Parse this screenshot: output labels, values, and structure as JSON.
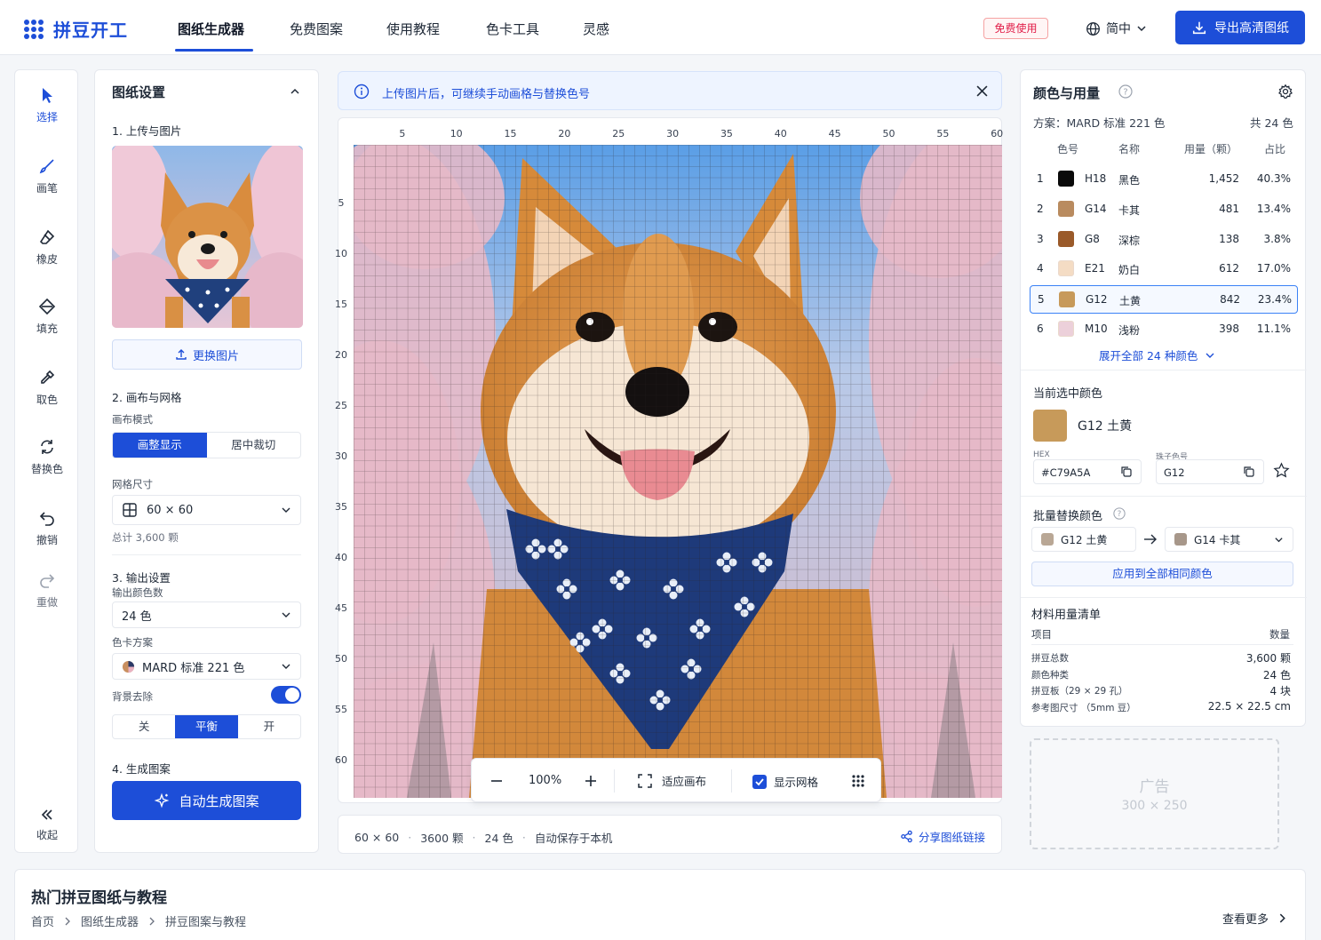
{
  "brand": {
    "name": "拼豆开工",
    "color": "#1d4ed8"
  },
  "nav": {
    "items": [
      "图纸生成器",
      "免费图案",
      "使用教程",
      "色卡工具",
      "灵感"
    ],
    "active": "图纸生成器",
    "free_badge": "免费使用",
    "language": "简中",
    "export_label": "导出高清图纸"
  },
  "tools": [
    {
      "label": "选择",
      "icon": "cursor-icon"
    },
    {
      "label": "画笔",
      "icon": "brush-icon"
    },
    {
      "label": "橡皮",
      "icon": "eraser-icon"
    },
    {
      "label": "填充",
      "icon": "fill-icon"
    },
    {
      "label": "取色",
      "icon": "eyedropper-icon"
    },
    {
      "label": "替换色",
      "icon": "replace-color-icon"
    },
    {
      "label": "撤销",
      "icon": "undo-icon"
    },
    {
      "label": "重做",
      "icon": "redo-icon"
    }
  ],
  "collapse_label": "收起",
  "settings": {
    "title": "图纸设置",
    "step1": "1. 上传与图片",
    "replace_image": "更换图片",
    "step2": "2. 画布与网格",
    "canvas_mode_label": "画布模式",
    "canvas_modes": [
      "画整显示",
      "居中裁切"
    ],
    "grid_size_label": "网格尺寸",
    "grid_size": "60 × 60",
    "total": "总计 3,600 颗",
    "step3": "3. 输出设置",
    "output_colors_label": "输出颜色数",
    "output_colors": "24 色",
    "palette_label": "色卡方案",
    "palette": "MARD 标准 221 色",
    "bg_remove_label": "背景去除",
    "bg_remove_on": true,
    "bg_levels": [
      "关",
      "平衡",
      "开"
    ],
    "bg_level_selected": "平衡",
    "step4": "4. 生成图案",
    "generate_label": "自动生成图案"
  },
  "banner": {
    "text": "上传图片后，可继续手动画格与替换色号"
  },
  "ruler": {
    "top": [
      "5",
      "10",
      "15",
      "20",
      "25",
      "30",
      "35",
      "40",
      "45",
      "50",
      "55",
      "60"
    ],
    "left": [
      "5",
      "10",
      "15",
      "20",
      "25",
      "30",
      "35",
      "40",
      "45",
      "50",
      "55",
      "60"
    ]
  },
  "canvas_toolbar": {
    "zoom": "100%",
    "fit_label": "适应画布",
    "show_grid_label": "显示网格",
    "show_grid": true
  },
  "status": {
    "items": [
      "60 × 60",
      "3600 颗",
      "24 色",
      "自动保存于本机"
    ],
    "share_label": "分享图纸链接"
  },
  "colors_panel": {
    "title": "颜色与用量",
    "scheme": "方案：MARD 标准 221 色",
    "count": "共 24 色",
    "headers": [
      "色号",
      "名称",
      "用量（颗）",
      "占比"
    ],
    "rows": [
      {
        "idx": "1",
        "code": "H18",
        "name": "黑色",
        "qty": "1,452",
        "pct": "40.3%",
        "color": "#0a0a0a"
      },
      {
        "idx": "2",
        "code": "G14",
        "name": "卡其",
        "qty": "481",
        "pct": "13.4%",
        "color": "#b98b5f"
      },
      {
        "idx": "3",
        "code": "G8",
        "name": "深棕",
        "qty": "138",
        "pct": "3.8%",
        "color": "#9a5a2a"
      },
      {
        "idx": "4",
        "code": "E21",
        "name": "奶白",
        "qty": "612",
        "pct": "17.0%",
        "color": "#f4dcc4"
      },
      {
        "idx": "5",
        "code": "G12",
        "name": "土黄",
        "qty": "842",
        "pct": "23.4%",
        "color": "#c79a5a"
      },
      {
        "idx": "6",
        "code": "M10",
        "name": "浅粉",
        "qty": "398",
        "pct": "11.1%",
        "color": "#ecd0da"
      }
    ],
    "selected_row": "5",
    "expand_label": "展开全部 24 种颜色",
    "current_title": "当前选中颜色",
    "current_name": "G12 土黄",
    "current_color": "#c79a5a",
    "hex_label": "HEX",
    "hex_value": "#C79A5A",
    "bead_label": "珠子色号",
    "bead_value": "G12",
    "batch_title": "批量替换颜色",
    "batch_from": "G12 土黄",
    "batch_from_color": "#b9a795",
    "batch_to": "G14 卡其",
    "batch_to_color": "#a7978a",
    "apply_label": "应用到全部相同颜色",
    "materials_title": "材料用量清单",
    "materials_headers": [
      "项目",
      "数量"
    ],
    "materials": [
      {
        "item": "拼豆总数",
        "value": "3,600 颗"
      },
      {
        "item": "颜色种类",
        "value": "24 色"
      },
      {
        "item": "拼豆板（29 × 29 孔）",
        "value": "4 块"
      },
      {
        "item": "参考图尺寸 （5mm 豆）",
        "value": "22.5 × 22.5 cm"
      }
    ]
  },
  "ad": {
    "title": "广告",
    "size": "300 × 250"
  },
  "bottom": {
    "title": "热门拼豆图纸与教程",
    "breadcrumb": [
      "首页",
      "图纸生成器",
      "拼豆图案与教程"
    ],
    "more_label": "查看更多"
  }
}
